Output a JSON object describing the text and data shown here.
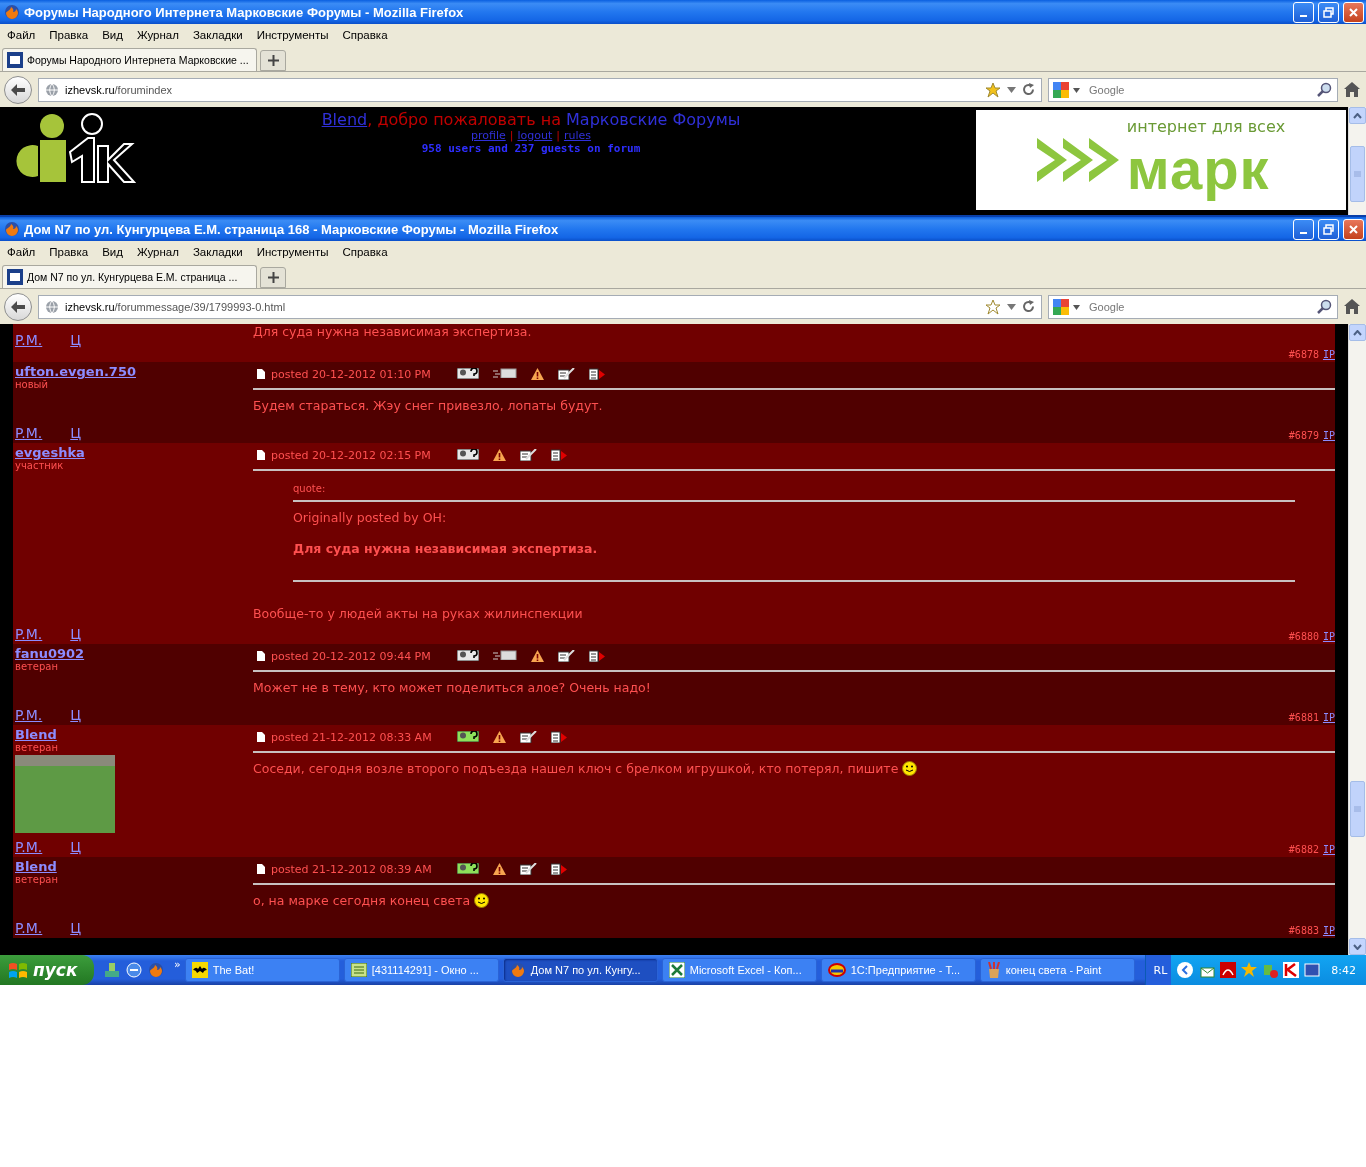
{
  "window_back": {
    "title": "Форумы Народного Интернета Марковские Форумы - Mozilla Firefox",
    "menu": [
      "Файл",
      "Правка",
      "Вид",
      "Журнал",
      "Закладки",
      "Инструменты",
      "Справка"
    ],
    "tab": "Форумы Народного Интернета Марковские ...",
    "url_host": "izhevsk.ru",
    "url_path": "/forumindex",
    "bookmarked": true,
    "search_placeholder": "Google",
    "header": {
      "user": "Blend",
      "welcome": ", добро пожаловать на ",
      "forum": "Марковские Форумы",
      "links": [
        "profile",
        "logout",
        "rules"
      ],
      "separator": "|",
      "stats": "958 users and 237 guests on forum",
      "banner_tagline": "интернет для всех",
      "banner_name": "марк"
    }
  },
  "window_front": {
    "title": "Дом N7 по ул. Кунгурцева Е.М. страница 168 - Марковские Форумы - Mozilla Firefox",
    "menu": [
      "Файл",
      "Правка",
      "Вид",
      "Журнал",
      "Закладки",
      "Инструменты",
      "Справка"
    ],
    "tab": "Дом N7 по ул. Кунгурцева Е.М. страница ...",
    "url_host": "izhevsk.ru",
    "url_path": "/forummessage/39/1799993-0.html",
    "bookmarked": false,
    "search_placeholder": "Google",
    "posts": [
      {
        "kind": "partial",
        "body": "Для суда нужна независимая экспертиза.",
        "pm": "P.M.",
        "extra": "Ц",
        "number": "#6878",
        "ip": "IP"
      },
      {
        "kind": "post",
        "author": "ufton.evgen.750",
        "rank": "новый",
        "avatar": false,
        "date": "posted 20-12-2012 01:10 PM",
        "actions": [
          {
            "kind": "quote"
          },
          {
            "kind": "mail"
          },
          {
            "kind": "warn"
          },
          {
            "kind": "edit"
          },
          {
            "kind": "report"
          }
        ],
        "body": "Будем стараться. Жэу снег привезло, лопаты будут.",
        "smiley": false,
        "pm": "P.M.",
        "extra": "Ц",
        "number": "#6879",
        "ip": "IP"
      },
      {
        "kind": "post",
        "author": "evgeshka",
        "rank": "участник",
        "avatar": false,
        "date": "posted 20-12-2012 02:15 PM",
        "actions": [
          {
            "kind": "quote"
          },
          {
            "kind": "warn"
          },
          {
            "kind": "edit"
          },
          {
            "kind": "report"
          }
        ],
        "quote": {
          "label": "quote:",
          "origin": "Originally posted by OH:",
          "text": "Для суда нужна независимая экспертиза."
        },
        "body": "Вообще-то у людей акты на руках жилинспекции",
        "smiley": false,
        "pm": "P.M.",
        "extra": "Ц",
        "number": "#6880",
        "ip": "IP"
      },
      {
        "kind": "post",
        "author": "fanu0902",
        "rank": "ветеран",
        "avatar": false,
        "date": "posted 20-12-2012 09:44 PM",
        "actions": [
          {
            "kind": "quote"
          },
          {
            "kind": "mail"
          },
          {
            "kind": "warn"
          },
          {
            "kind": "edit"
          },
          {
            "kind": "report"
          }
        ],
        "body": "Может не в тему, кто может поделиться алое? Очень надо!",
        "smiley": false,
        "pm": "P.M.",
        "extra": "Ц",
        "number": "#6881",
        "ip": "IP"
      },
      {
        "kind": "post",
        "author": "Blend",
        "rank": "ветеран",
        "avatar": true,
        "date": "posted 21-12-2012 08:33 AM",
        "actions": [
          {
            "kind": "quote_online"
          },
          {
            "kind": "warn"
          },
          {
            "kind": "edit"
          },
          {
            "kind": "report"
          }
        ],
        "body": "Соседи, сегодня возле второго подъезда нашел ключ с брелком игрушкой, кто потерял, пишите",
        "smiley": true,
        "pm": "P.M.",
        "extra": "Ц",
        "number": "#6882",
        "ip": "IP"
      },
      {
        "kind": "post",
        "author": "Blend",
        "rank": "ветеран",
        "avatar": false,
        "date": "posted 21-12-2012 08:39 AM",
        "actions": [
          {
            "kind": "quote_online"
          },
          {
            "kind": "warn"
          },
          {
            "kind": "edit"
          },
          {
            "kind": "report"
          }
        ],
        "body": "о, на марке сегодня конец света",
        "smiley": true,
        "pm": "P.M.",
        "extra": "Ц",
        "number": "#6883",
        "ip": "IP"
      }
    ]
  },
  "taskbar": {
    "start": "пуск",
    "chevron": "»",
    "tasks": [
      {
        "kind": "bat",
        "label": "The Bat!",
        "selected": false
      },
      {
        "kind": "window",
        "label": "[431114291] - Окно ...",
        "selected": false
      },
      {
        "kind": "firefox",
        "label": "Дом N7 по ул. Кунгу...",
        "selected": true
      },
      {
        "kind": "excel",
        "label": "Microsoft Excel - Коп...",
        "selected": false
      },
      {
        "kind": "onec",
        "label": "1С:Предприятие - Т...",
        "selected": false
      },
      {
        "kind": "paint",
        "label": "конец света - Paint",
        "selected": false
      }
    ],
    "language": "RL",
    "time": "8:42"
  }
}
